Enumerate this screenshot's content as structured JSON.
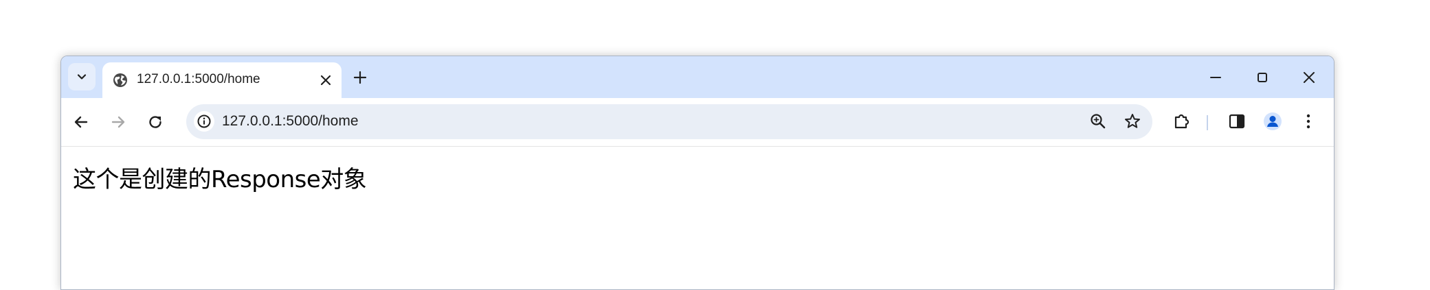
{
  "browser": {
    "tab": {
      "title": "127.0.0.1:5000/home",
      "favicon": "globe-icon"
    },
    "address_bar": {
      "url": "127.0.0.1:5000/home",
      "site_info_icon": "info-icon"
    },
    "toolbar_icons": [
      "back-icon",
      "forward-icon",
      "reload-icon",
      "zoom-icon",
      "bookmark-star-icon",
      "extensions-icon",
      "side-panel-icon",
      "profile-icon",
      "menu-icon"
    ],
    "window_controls": [
      "minimize-icon",
      "maximize-icon",
      "close-icon"
    ],
    "colors": {
      "tabstrip": "#d3e3fd",
      "omnibox": "#e9eef6",
      "profile": "#0b57d0"
    }
  },
  "page": {
    "body_text": "这个是创建的Response对象"
  }
}
